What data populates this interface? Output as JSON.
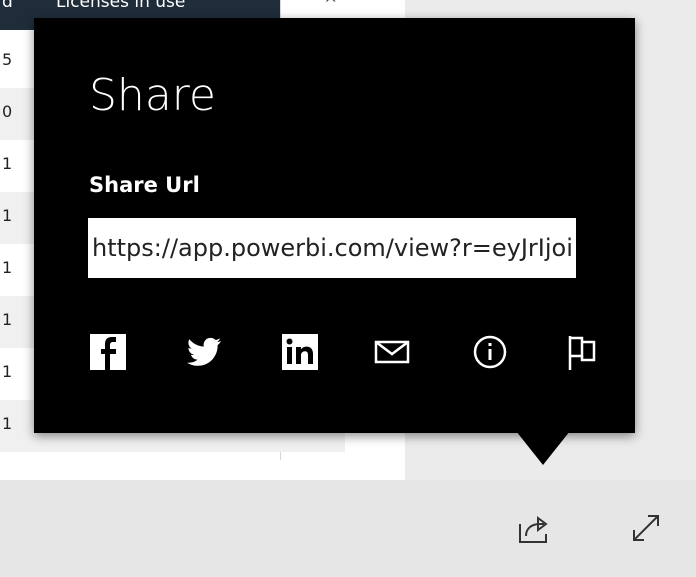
{
  "table": {
    "headers": [
      "d",
      "Licenses in use"
    ],
    "rows": [
      "5",
      "0",
      "1",
      "1",
      "1",
      "1",
      "1",
      "1"
    ]
  },
  "share_flyout": {
    "title": "Share",
    "url_label": "Share Url",
    "url_value": "https://app.powerbi.com/view?r=eyJrIjoi",
    "icons": [
      "facebook-icon",
      "twitter-icon",
      "linkedin-icon",
      "email-icon",
      "info-icon",
      "flag-icon"
    ]
  },
  "toolbar": {
    "icons": [
      "share-icon",
      "expand-icon"
    ]
  },
  "colors": {
    "flyout_bg": "#000000",
    "bar_bg": "#e6e6e6",
    "text_on_dark": "#ffffff"
  }
}
